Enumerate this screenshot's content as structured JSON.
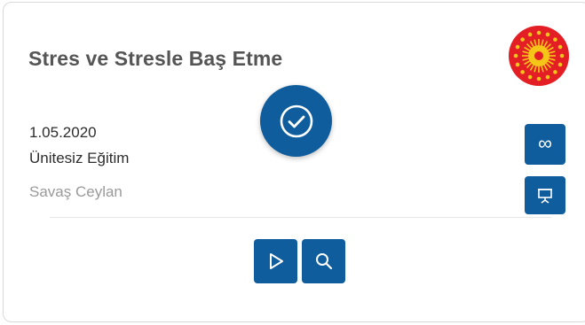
{
  "course": {
    "title": "Stres ve Stresle Baş Etme",
    "date": "1.05.2020",
    "type": "Ünitesiz Eğitim",
    "author": "Savaş Ceylan"
  },
  "icons": {
    "seal": "presidential-seal-icon",
    "status": "check-circle-icon",
    "infinity": "infinity-icon",
    "presentation": "presentation-icon",
    "play": "play-icon",
    "search": "search-icon"
  },
  "colors": {
    "accent": "#0f5d9d",
    "seal_red": "#e31e24",
    "seal_gold": "#f5c518",
    "title": "#555555",
    "muted": "#9a9a9a"
  },
  "symbols": {
    "infinity": "∞"
  }
}
